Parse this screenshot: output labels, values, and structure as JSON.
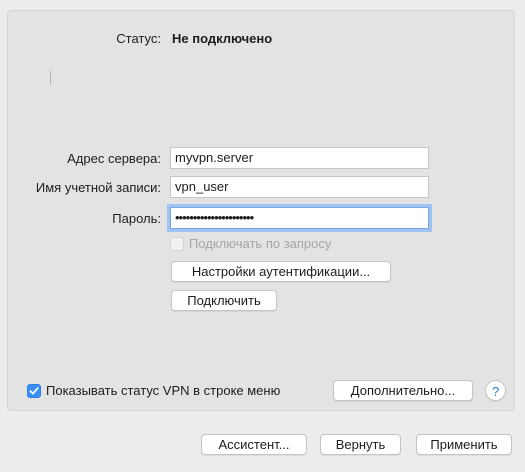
{
  "status": {
    "label": "Статус:",
    "value": "Не подключено"
  },
  "form": {
    "server_label": "Адрес сервера:",
    "server_value": "myvpn.server",
    "account_label": "Имя учетной записи:",
    "account_value": "vpn_user",
    "password_label": "Пароль:",
    "password_masked": "••••••••••••••••••••••",
    "on_demand_label": "Подключать по запросу",
    "on_demand_checked": false,
    "on_demand_enabled": false,
    "auth_settings_button": "Настройки аутентификации...",
    "connect_button": "Подключить"
  },
  "panel_footer": {
    "show_vpn_status_label": "Показывать статус VPN в строке меню",
    "show_vpn_status_checked": true,
    "advanced_button": "Дополнительно...",
    "help_button": "?"
  },
  "window_footer": {
    "assistant_button": "Ассистент...",
    "revert_button": "Вернуть",
    "apply_button": "Применить"
  },
  "colors": {
    "accent": "#3b8ef4",
    "focus_ring": "#9fc4f3"
  },
  "icons": {
    "checkmark": "checkmark-icon",
    "help": "question-mark-icon"
  }
}
